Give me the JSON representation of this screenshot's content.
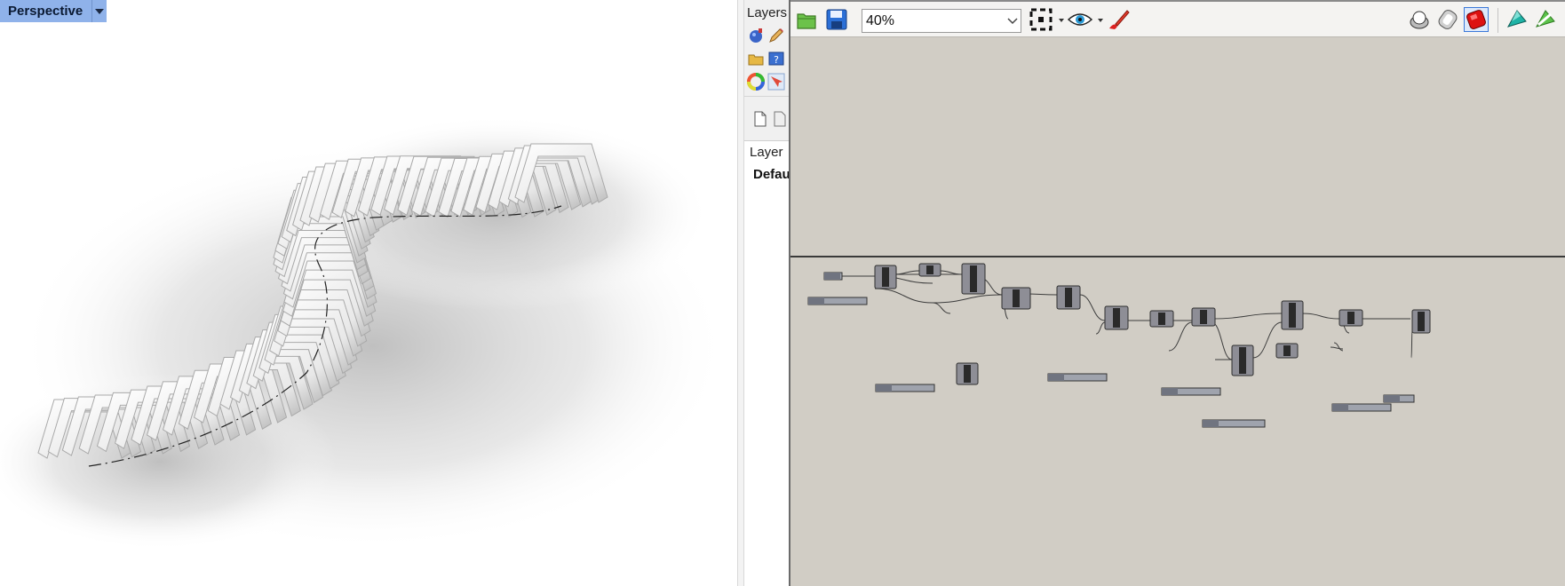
{
  "viewport": {
    "name": "Perspective"
  },
  "layers_panel": {
    "title": "Layers",
    "column_header": "Layer",
    "rows": [
      "Defau"
    ]
  },
  "grasshopper": {
    "zoom_level": "40%",
    "toolbar_icons": [
      "open-file-icon",
      "save-file-icon",
      "zoom-extents-icon",
      "preview-eye-icon",
      "sketch-brush-icon",
      "preview-wire-icon",
      "preview-shaded-icon",
      "preview-selected-icon",
      "bake-icon",
      "bake-selected-icon"
    ],
    "canvas_color": "#d1cdc5",
    "wire_color": "#3c3c3c",
    "component_fill": "#8e8e96",
    "slider_fill": "#9fa3ad"
  }
}
